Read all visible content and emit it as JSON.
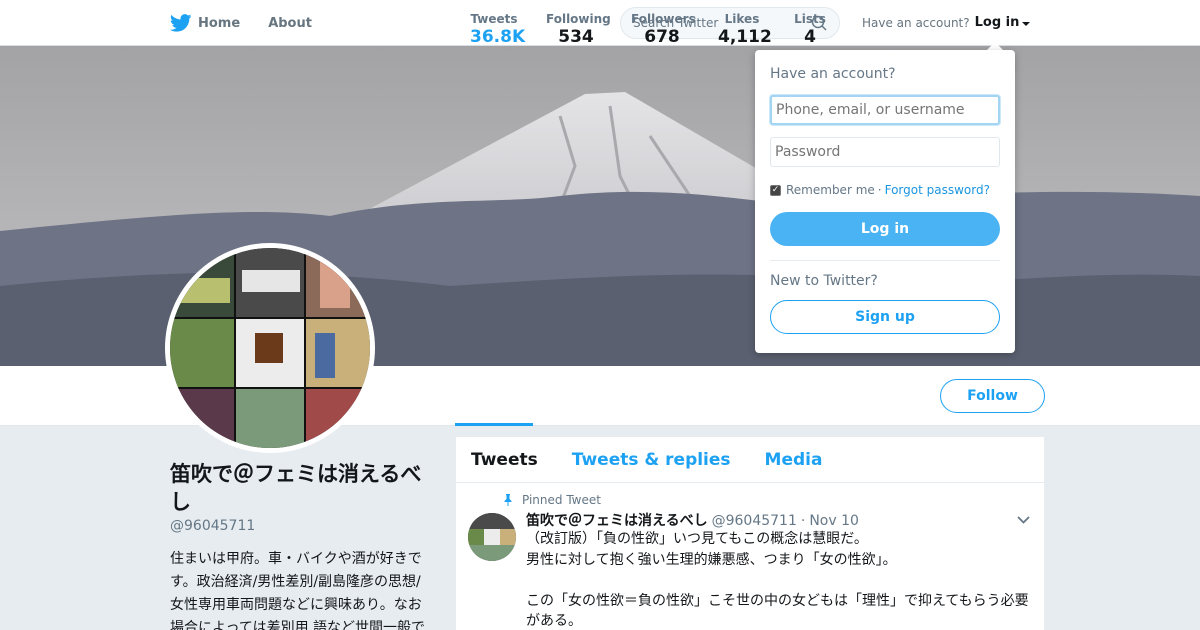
{
  "nav": {
    "home": "Home",
    "about": "About",
    "search_placeholder": "Search Twitter",
    "have_account": "Have an account?",
    "login": "Log in"
  },
  "profile": {
    "name": "笛吹で＠フェミは消えるべし",
    "handle": "@96045711",
    "bio": "住まいは甲府。車・バイクや酒が好きです。政治経済/男性差別/副島隆彦の思想/女性専用車両問題などに興味あり。なお場合によっては差別用 語など世間一般で"
  },
  "stats": [
    {
      "label": "Tweets",
      "value": "36.8K"
    },
    {
      "label": "Following",
      "value": "534"
    },
    {
      "label": "Followers",
      "value": "678"
    },
    {
      "label": "Likes",
      "value": "4,112"
    },
    {
      "label": "Lists",
      "value": "4"
    }
  ],
  "follow_label": "Follow",
  "tabs": [
    "Tweets",
    "Tweets & replies",
    "Media"
  ],
  "tweet": {
    "pinned": "Pinned Tweet",
    "name": "笛吹で＠フェミは消えるべし",
    "handle": "@96045711",
    "dot": "·",
    "date": "Nov 10",
    "line1": "（改訂版）「負の性欲」いつ見てもこの概念は慧眼だ。",
    "line2": "男性に対して抱く強い生理的嫌悪感、つまり「女の性欲」。",
    "line3": "この「女の性欲＝負の性欲」こそ世の中の女どもは「理性」で抑えてもらう必要がある。"
  },
  "login_dropdown": {
    "title": "Have an account?",
    "username_placeholder": "Phone, email, or username",
    "password_placeholder": "Password",
    "remember": "Remember me",
    "sep": "·",
    "forgot": "Forgot password?",
    "login_button": "Log in",
    "new_to": "New to Twitter?",
    "signup_button": "Sign up"
  },
  "colors": {
    "accent": "#1da1f2",
    "login_button": "#4ab3f4"
  }
}
